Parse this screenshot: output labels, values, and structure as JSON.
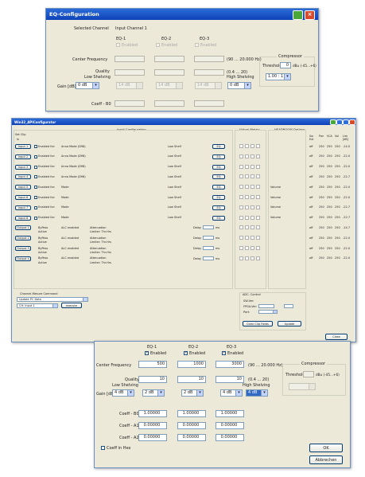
{
  "top_dialog": {
    "title": "EQ-Configuration",
    "selected_channel_label": "Selected Channel",
    "selected_channel_value": "Input Channel 1",
    "eq_headers": [
      "EQ-1",
      "EQ-2",
      "EQ-3"
    ],
    "enabled_label": "Enabled",
    "center_frequency_label": "Center Frequency",
    "center_frequency_range": "(90 ... 20.000 Hz)",
    "quality_label": "Quality",
    "quality_range": "(0.4 ... 20)",
    "low_shelving_label": "Low Shelving",
    "high_shelving_label": "High Shelving",
    "gain_label": "Gain [dB]",
    "gain_values": [
      "0 dB",
      "14 dB",
      "14 dB",
      "14 dB",
      "0 dB"
    ],
    "coeff_label": "Coeff - B0",
    "compressor_label": "Compressor",
    "threshold_label": "Threshold",
    "threshold_value": "0",
    "threshold_range": "dBu (-45...+6)",
    "ratio_value": "1.00 : 1"
  },
  "main_window": {
    "title": "Win32_APIConfigurator",
    "input_config_header": "Input Configuration",
    "virtual_matrix_header": "Virtual Matrix",
    "headroom_header": "HEADROOM Options",
    "set_clip_label": "Set Clip",
    "set_clip_sub": "In",
    "input_buttons": [
      "Input 1",
      "Input 2",
      "Input 3",
      "Input 4",
      "Input 5",
      "Input 6",
      "Input 7",
      "Input 8"
    ],
    "enabled_label": "Enabled for:",
    "analog_mode_label": "Anna Mode (D98)",
    "mode_label": "Mode",
    "low_shelf_label": "Low Shelf",
    "eq_button": "EQ",
    "output_buttons": [
      "Output 1",
      "Output 2",
      "Output 3",
      "Output 4"
    ],
    "bypass_label": "ByPass",
    "active_label": "Active",
    "alc_label": "ALC enabled",
    "attenuation_label": "Attenuation",
    "limiter_label": "Limiter: Thr.Hrs",
    "delay_label": "Delay",
    "ms_label": "ms",
    "col_headers": [
      "Sw Ext",
      "Pwr",
      "VCA",
      "Vol",
      "Lim [dB]"
    ],
    "row_values": [
      [
        "off",
        "250",
        "250",
        "250",
        "-14.0"
      ],
      [
        "off",
        "250",
        "250",
        "250",
        "-22.0"
      ],
      [
        "off",
        "250",
        "250",
        "250",
        "-22.0"
      ],
      [
        "off",
        "250",
        "250",
        "250",
        "-22.7"
      ],
      [
        "off",
        "250",
        "250",
        "250",
        "-22.0"
      ],
      [
        "off",
        "250",
        "250",
        "250",
        "-22.0"
      ],
      [
        "off",
        "250",
        "250",
        "250",
        "-22.7"
      ],
      [
        "off",
        "250",
        "250",
        "250",
        "-22.7"
      ],
      [
        "off",
        "250",
        "250",
        "250",
        "-14.7"
      ],
      [
        "off",
        "250",
        "250",
        "250",
        "-22.0"
      ],
      [
        "off",
        "250",
        "250",
        "250",
        "-22.0"
      ],
      [
        "off",
        "250",
        "250",
        "250",
        "-22.0"
      ]
    ],
    "volume_label": "Volume",
    "channel_command_label": "Channel-Mesure Command",
    "channel_combo_1": "Update PC Data",
    "channel_combo_2": "CH: Input 1",
    "execute_button": "execute",
    "adc_control_label": "ADC- Control",
    "adc_values": [
      "SW-Ver:",
      "FPGA-Ver:",
      "Port:"
    ],
    "clear_button": "Clear Clip Fields",
    "update_button": "Update",
    "close_button": "Close"
  },
  "bottom_dialog": {
    "eq_headers": [
      "EQ-1",
      "EQ-2",
      "EQ-3"
    ],
    "enabled_label": "Enabled",
    "center_frequency_label": "Center Frequency",
    "center_frequency_values": [
      "500",
      "1000",
      "3000"
    ],
    "center_frequency_range": "(90 ... 20.000 Hz)",
    "quality_label": "Quality",
    "quality_values": [
      "10",
      "10",
      "10"
    ],
    "quality_range": "(0.4 ... 20)",
    "low_shelving_label": "Low Shelving",
    "high_shelving_label": "High Shelving",
    "gain_label": "Gain [dB]",
    "gain_values": [
      "4 dB",
      "2 dB",
      "2 dB",
      "4 dB",
      "4 dB"
    ],
    "coeff_rows": [
      {
        "label": "Coeff - B0",
        "values": [
          "1.00000",
          "1.00000",
          "1.00000"
        ]
      },
      {
        "label": "Coeff - A1",
        "values": [
          "0.00000",
          "0.00000",
          "0.00000"
        ]
      },
      {
        "label": "Coeff - A2",
        "values": [
          "0.00000",
          "0.00000",
          "0.00000"
        ]
      }
    ],
    "coeff_hex_label": "Coeff in Hex",
    "compressor_label": "Compressor",
    "threshold_label": "Threshold",
    "threshold_range": "dBu (-45...+6)",
    "ok_button": "OK",
    "cancel_button": "Abbrechen"
  },
  "colors": {
    "title_blue": "#0e43b8",
    "close_red": "#d84a2b",
    "help_green": "#4aa83a",
    "dialog_bg": "#ece9d8"
  }
}
